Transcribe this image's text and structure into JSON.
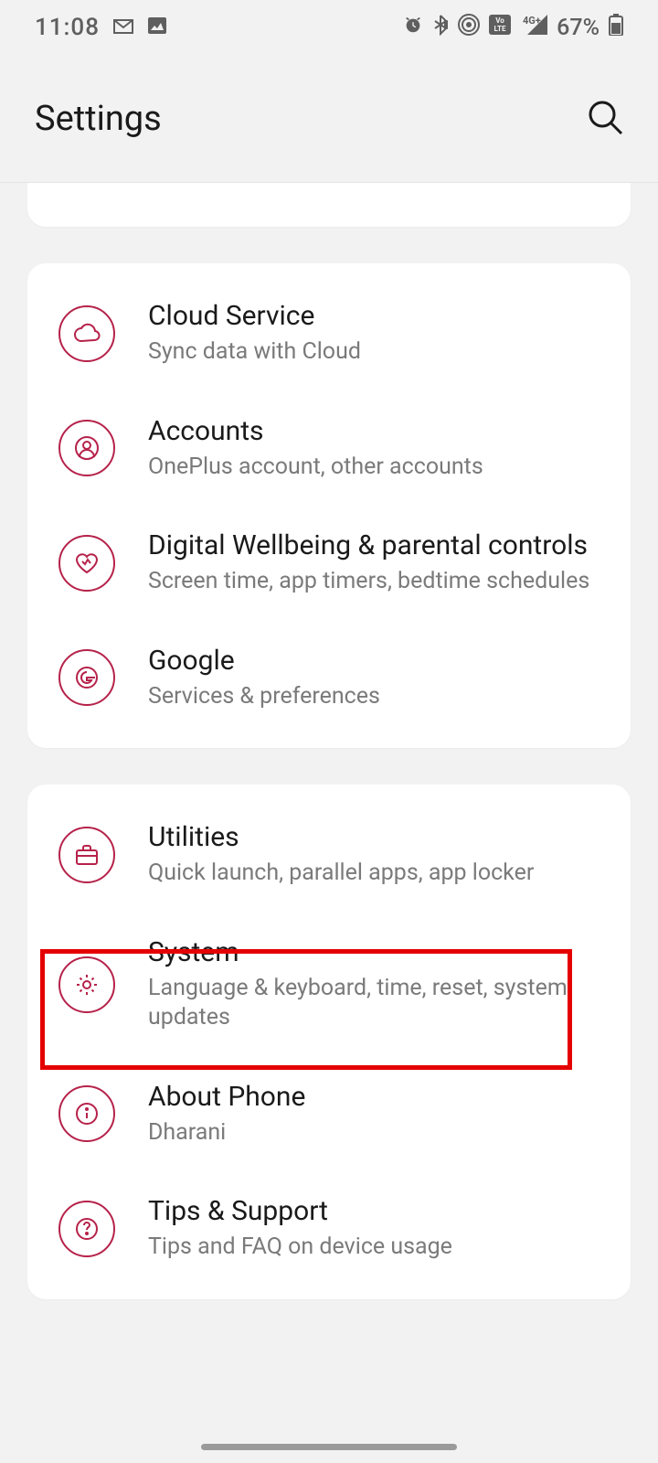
{
  "status": {
    "time": "11:08",
    "battery": "67%"
  },
  "header": {
    "title": "Settings"
  },
  "group1": {
    "cloud": {
      "title": "Cloud Service",
      "subtitle": "Sync data with Cloud"
    },
    "accounts": {
      "title": "Accounts",
      "subtitle": "OnePlus account, other accounts"
    },
    "wellbeing": {
      "title": "Digital Wellbeing & parental controls",
      "subtitle": "Screen time, app timers, bedtime schedules"
    },
    "google": {
      "title": "Google",
      "subtitle": "Services & preferences"
    }
  },
  "group2": {
    "utilities": {
      "title": "Utilities",
      "subtitle": "Quick launch, parallel apps, app locker"
    },
    "system": {
      "title": "System",
      "subtitle": "Language & keyboard, time, reset, system updates"
    },
    "about": {
      "title": "About Phone",
      "subtitle": "Dharani"
    },
    "tips": {
      "title": "Tips & Support",
      "subtitle": "Tips and FAQ on device usage"
    }
  }
}
